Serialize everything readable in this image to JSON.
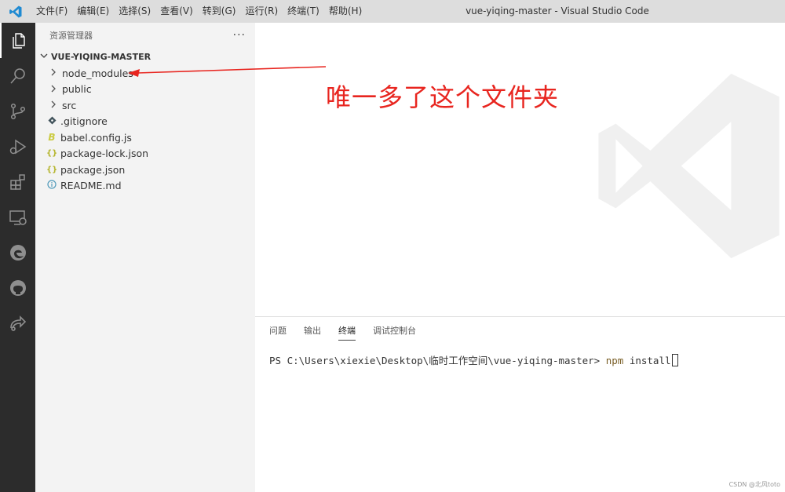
{
  "titlebar": {
    "menu": [
      "文件(F)",
      "编辑(E)",
      "选择(S)",
      "查看(V)",
      "转到(G)",
      "运行(R)",
      "终端(T)",
      "帮助(H)"
    ],
    "window_title": "vue-yiqing-master - Visual Studio Code"
  },
  "activity_bar": {
    "items": [
      "explorer-icon",
      "search-icon",
      "source-control-icon",
      "run-debug-icon",
      "extensions-icon",
      "remote-explorer-icon",
      "edge-icon",
      "github-icon",
      "live-share-icon"
    ]
  },
  "sidebar": {
    "title": "资源管理器",
    "more": "···",
    "folder": "VUE-YIQING-MASTER",
    "items": [
      {
        "label": "node_modules",
        "type": "folder"
      },
      {
        "label": "public",
        "type": "folder"
      },
      {
        "label": "src",
        "type": "folder"
      },
      {
        "label": ".gitignore",
        "type": "file",
        "icon": "git-icon"
      },
      {
        "label": "babel.config.js",
        "type": "file",
        "icon": "babel-icon"
      },
      {
        "label": "package-lock.json",
        "type": "file",
        "icon": "json-icon"
      },
      {
        "label": "package.json",
        "type": "file",
        "icon": "json-icon"
      },
      {
        "label": "README.md",
        "type": "file",
        "icon": "info-icon"
      }
    ]
  },
  "panel": {
    "tabs": [
      "问题",
      "输出",
      "终端",
      "调试控制台"
    ],
    "active_tab": "终端",
    "terminal": {
      "prompt": "PS C:\\Users\\xiexie\\Desktop\\临时工作空间\\vue-yiqing-master> ",
      "command": "npm",
      "args": " install"
    }
  },
  "annotation": {
    "text": "唯一多了这个文件夹",
    "color": "#e8251f"
  },
  "credit": "CSDN @北风toto",
  "colors": {
    "activity_bar": "#2c2c2c",
    "sidebar": "#f3f3f3",
    "titlebar": "#dddddd",
    "accent": "#0078d4"
  }
}
